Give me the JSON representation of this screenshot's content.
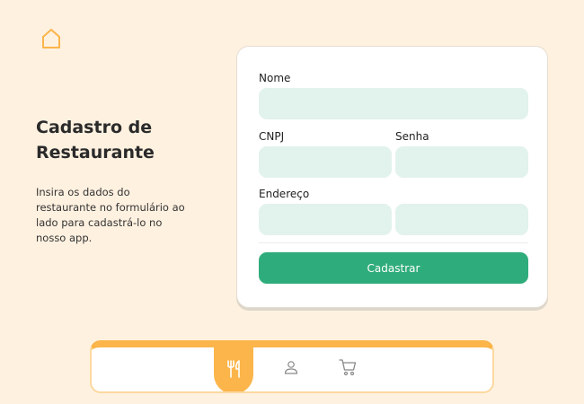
{
  "header": {
    "home_icon": "home-icon"
  },
  "intro": {
    "title_line1": "Cadastro de",
    "title_line2": "Restaurante",
    "desc_line1": "Insira os dados do",
    "desc_line2": "restaurante no formulário ao",
    "desc_line3": "lado para cadastrá-lo no",
    "desc_line4": "nosso app."
  },
  "form": {
    "nome_label": "Nome",
    "nome_value": "",
    "cnpj_label": "CNPJ",
    "cnpj_value": "",
    "senha_label": "Senha",
    "senha_value": "",
    "endereco_label": "Endereço",
    "endereco_value": "",
    "endereco2_value": "",
    "submit_label": "Cadastrar"
  },
  "nav": {
    "items": [
      {
        "icon": "restaurant-icon",
        "active": true
      },
      {
        "icon": "user-icon",
        "active": false
      },
      {
        "icon": "cart-icon",
        "active": false
      }
    ]
  },
  "colors": {
    "background": "#fff1e0",
    "accent": "#fbb54b",
    "field": "#e2f2ec",
    "primary_button": "#2fac7b"
  }
}
